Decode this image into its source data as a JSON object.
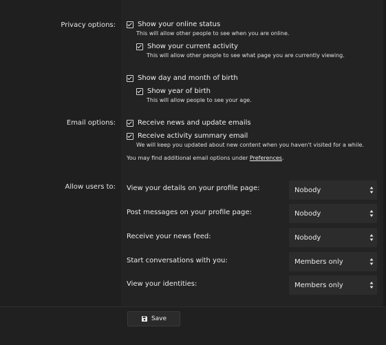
{
  "privacy": {
    "label": "Privacy options:",
    "show_online_status": "Show your online status",
    "show_online_status_hint": "This will allow other people to see when you are online.",
    "show_current_activity": "Show your current activity",
    "show_current_activity_hint": "This will allow other people to see what page you are currently viewing.",
    "show_dob": "Show day and month of birth",
    "show_year": "Show year of birth",
    "show_year_hint": "This will allow people to see your age."
  },
  "email": {
    "label": "Email options:",
    "receive_news": "Receive news and update emails",
    "receive_summary": "Receive activity summary email",
    "receive_summary_hint": "We will keep you updated about new content when you haven't visited for a while.",
    "note_prefix": "You may find additional email options under ",
    "note_link": "Preferences",
    "note_suffix": "."
  },
  "allow": {
    "label": "Allow users to:",
    "rows": [
      {
        "label": "View your details on your profile page:",
        "value": "Nobody"
      },
      {
        "label": "Post messages on your profile page:",
        "value": "Nobody"
      },
      {
        "label": "Receive your news feed:",
        "value": "Nobody"
      },
      {
        "label": "Start conversations with you:",
        "value": "Members only"
      },
      {
        "label": "View your identities:",
        "value": "Members only"
      }
    ]
  },
  "footer": {
    "save_label": "Save",
    "save_icon": "floppy-disk-icon"
  }
}
